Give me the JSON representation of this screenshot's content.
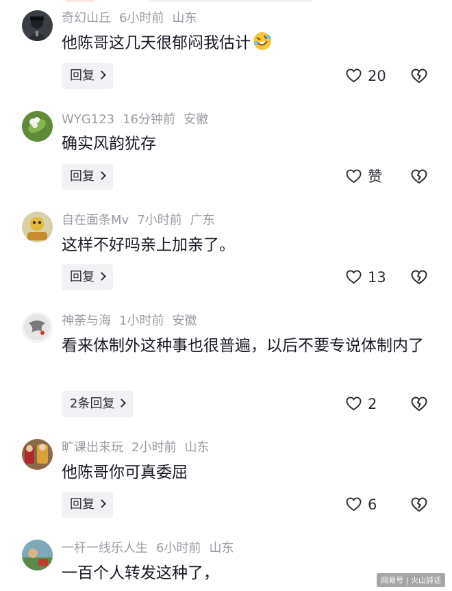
{
  "comments": [
    {
      "username": "奇幻山丘",
      "time": "6小时前",
      "location": "山东",
      "text": "他陈哥这几天很郁闷我估计",
      "emoji": "rolling-on-floor-laughing-emoji",
      "reply_label": "回复",
      "like_count": "20"
    },
    {
      "username": "WYG123",
      "time": "16分钟前",
      "location": "安徽",
      "text": "确实风韵犹存",
      "reply_label": "回复",
      "like_count": "赞"
    },
    {
      "username": "自在面条Mv",
      "time": "7小时前",
      "location": "广东",
      "text": "这样不好吗亲上加亲了。",
      "reply_label": "回复",
      "like_count": "13"
    },
    {
      "username": "神荼与海",
      "time": "1小时前",
      "location": "安徽",
      "text": "看来体制外这种事也很普遍，以后不要专说体制内了",
      "reply_label": "2条回复",
      "like_count": "2"
    },
    {
      "username": "旷课出来玩",
      "time": "2小时前",
      "location": "山东",
      "text": "他陈哥你可真委屈",
      "reply_label": "回复",
      "like_count": "6"
    },
    {
      "username": "一杆一线乐人生",
      "time": "6小时前",
      "location": "山东",
      "text": "一百个人转发这种了，"
    }
  ],
  "watermark": "网易号 | 火山詩话",
  "icons": {
    "like": "heart-icon",
    "dislike": "broken-heart-icon",
    "reply_arrow": "chevron-right-icon"
  },
  "colors": {
    "meta_text": "#9a9ca3",
    "body_text": "#161823",
    "reply_bg": "#f2f2f4"
  }
}
